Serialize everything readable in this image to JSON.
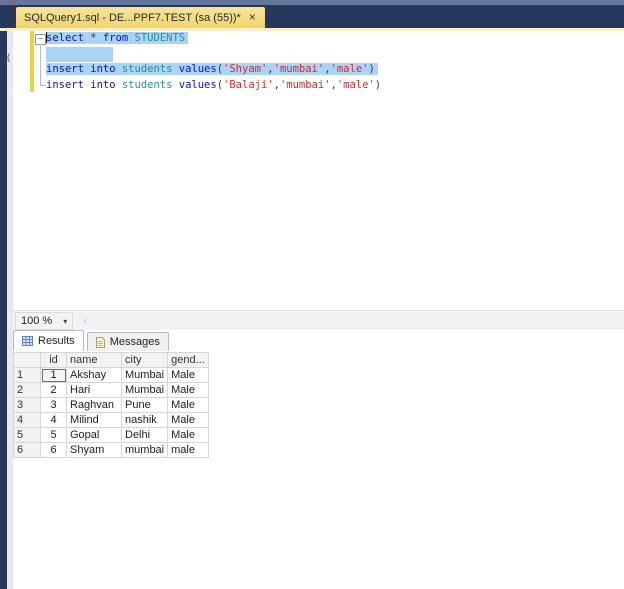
{
  "window": {
    "tab_title": "SQLQuery1.sql - DE...PPF7.TEST (sa (55))*",
    "close_glyph": "×"
  },
  "left_rail": {
    "collapsed_glyph": "("
  },
  "editor": {
    "outline_glyph": "−",
    "zoom_value": "100 %",
    "zoom_arrow": "▾",
    "scroll_left_arrow": "‹",
    "lines": [
      {
        "tokens": [
          {
            "text": "select "
          },
          {
            "text": "* "
          },
          {
            "text": "from "
          },
          {
            "text": "STUDENTS"
          }
        ]
      },
      {
        "tokens": []
      },
      {
        "tokens": [
          {
            "text": "insert into "
          },
          {
            "text": "students "
          },
          {
            "text": "values"
          },
          {
            "text": "("
          },
          {
            "text": "'Shyam'"
          },
          {
            "text": ","
          },
          {
            "text": "'mumbai'"
          },
          {
            "text": ","
          },
          {
            "text": "'male'"
          },
          {
            "text": ")"
          }
        ]
      },
      {
        "tokens": [
          {
            "text": "insert into "
          },
          {
            "text": "students "
          },
          {
            "text": "values"
          },
          {
            "text": "("
          },
          {
            "text": "'Balaji'"
          },
          {
            "text": ","
          },
          {
            "text": "'mumbai'"
          },
          {
            "text": ","
          },
          {
            "text": "'male'"
          },
          {
            "text": ")"
          }
        ]
      }
    ]
  },
  "colors": {
    "kw": "#1010d8",
    "ident": "#2b918a",
    "str": "#d42c2c",
    "punct": "#3c3c3c",
    "sel": "#a9d3f7",
    "tab": "#f2d469"
  },
  "results_pane": {
    "tabs": [
      {
        "label": "Results"
      },
      {
        "label": "Messages"
      }
    ],
    "grid": {
      "columns": [
        "id",
        "name",
        "city",
        "gend..."
      ],
      "rows": [
        {
          "n": "1",
          "id": "1",
          "name": "Akshay",
          "city": "Mumbai",
          "gender": "Male"
        },
        {
          "n": "2",
          "id": "2",
          "name": "Hari",
          "city": "Mumbai",
          "gender": "Male"
        },
        {
          "n": "3",
          "id": "3",
          "name": "Raghvan",
          "city": "Pune",
          "gender": "Male"
        },
        {
          "n": "4",
          "id": "4",
          "name": "Milind",
          "city": "nashik",
          "gender": "Male"
        },
        {
          "n": "5",
          "id": "5",
          "name": "Gopal",
          "city": "Delhi",
          "gender": "Male"
        },
        {
          "n": "6",
          "id": "6",
          "name": "Shyam",
          "city": "mumbai",
          "gender": "male"
        }
      ]
    }
  }
}
